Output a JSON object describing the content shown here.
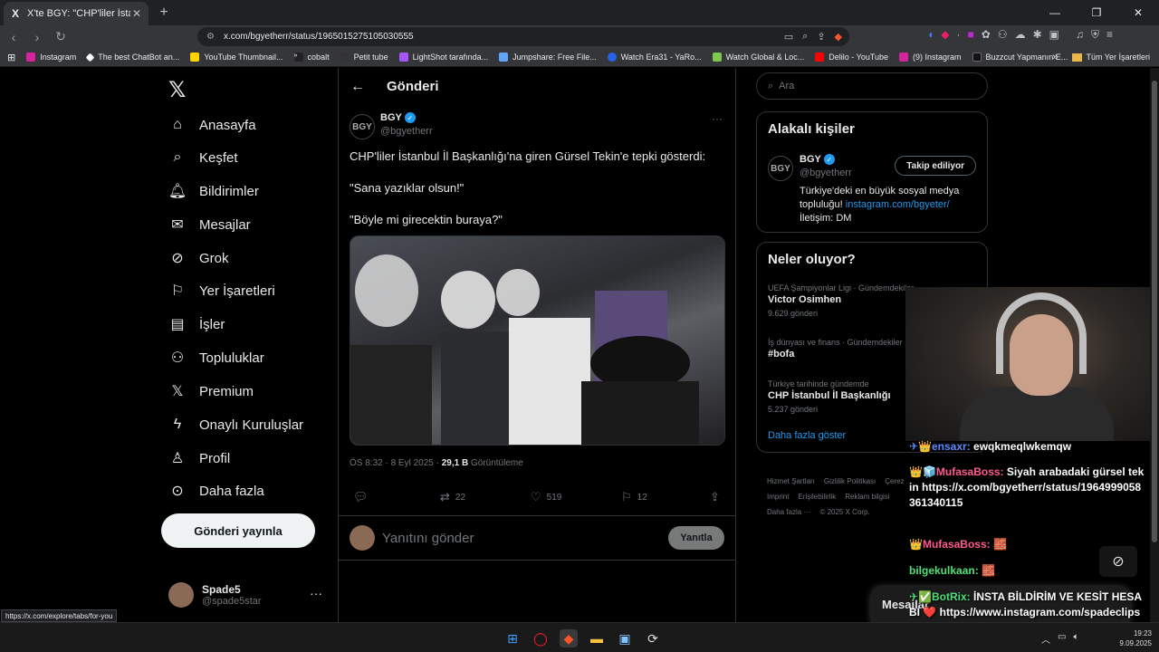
{
  "browser": {
    "tab_title": "X'te BGY: \"CHP'liler İstanbul İl",
    "url": "x.com/bgyetherr/status/1965015275105030555",
    "bookmarks": [
      "Instagram",
      "The best ChatBot an...",
      "YouTube Thumbnail...",
      "cobalt",
      "Petit tube",
      "LightShot tarafında...",
      "Jumpshare: Free File...",
      "Watch Era31 - YaRo...",
      "Watch Global & Loc...",
      "Delilo - YouTube",
      "(9) Instagram",
      "Buzzcut Yapmanın E..."
    ],
    "bookmarks_folder": "Tüm Yer İşaretleri",
    "status_url": "https://x.com/explore/tabs/for-you"
  },
  "nav": {
    "items": [
      "Anasayfa",
      "Keşfet",
      "Bildirimler",
      "Mesajlar",
      "Grok",
      "Yer İşaretleri",
      "İşler",
      "Topluluklar",
      "Premium",
      "Onaylı Kuruluşlar",
      "Profil",
      "Daha fazla"
    ],
    "post_button": "Gönderi yayınla",
    "account_name": "Spade5",
    "account_handle": "@spade5star"
  },
  "post": {
    "page_title": "Gönderi",
    "author_name": "BGY",
    "author_handle": "@bgyetherr",
    "avatar_text": "BGY",
    "text_lines": [
      "CHP'liler İstanbul İl Başkanlığı'na giren Gürsel Tekin'e tepki gösterdi:",
      "\"Sana yazıklar olsun!\"",
      "\"Böyle mi girecektin buraya?\""
    ],
    "time": "ÖS 8:32 · 8 Eyl 2025 ·",
    "views": "29,1 B",
    "views_label": "Görüntüleme",
    "reposts": "22",
    "likes": "519",
    "bookmarks": "12",
    "reply_placeholder": "Yanıtını gönder",
    "reply_button": "Yanıtla"
  },
  "sidebar": {
    "search_placeholder": "Ara",
    "related_title": "Alakalı kişiler",
    "related": {
      "name": "BGY",
      "handle": "@bgyetherr",
      "follow": "Takip ediliyor",
      "bio": "Türkiye'deki en büyük sosyal medya topluluğu!",
      "bio_link": "instagram.com/bgyeter/",
      "bio_contact": "İletişim: DM"
    },
    "trends_title": "Neler oluyor?",
    "trends": [
      {
        "category": "UEFA Şampiyonlar Ligi · Gündemdekiler",
        "name": "Victor Osimhen",
        "count": "9.629 gönderi"
      },
      {
        "category": "İş dünyası ve finans · Gündemdekiler",
        "name": "#bofa",
        "count": ""
      },
      {
        "category": "Türkiye tarihinde gündemde",
        "name": "CHP İstanbul İl Başkanlığı",
        "count": "5.237 gönderi"
      }
    ],
    "show_more": "Daha fazla göster",
    "footer": [
      "Hizmet Şartları",
      "Gizlilik Politikası",
      "Çerez",
      "Imprint",
      "Erişilebilirlik",
      "Reklam bilgisi",
      "Daha fazla ···",
      "© 2025 X Corp."
    ]
  },
  "stream": {
    "chat": [
      {
        "user": "ensaxr:",
        "text": "ewqkmeqlwkemqw",
        "color": "#5b8cff"
      },
      {
        "user": "MufasaBoss:",
        "text": "Siyah arabadaki gürsel tekin https://x.com/bgyetherr/status/1964999058361340115",
        "color": "#ff5a8c"
      },
      {
        "user": "MufasaBoss:",
        "text": "🧱",
        "color": "#ff5a8c"
      },
      {
        "user": "bilgekulkaan:",
        "text": "🧱",
        "color": "#4ee07a"
      },
      {
        "user": "BotRix:",
        "text": "İNSTA BİLDİRİM VE KESİT HESABI ❤️ https://www.instagram.com/spadeclips",
        "color": "#4ee07a"
      }
    ],
    "dm_label": "Mesajlar"
  },
  "taskbar": {
    "time": "19:23",
    "date": "9.09.2025"
  }
}
